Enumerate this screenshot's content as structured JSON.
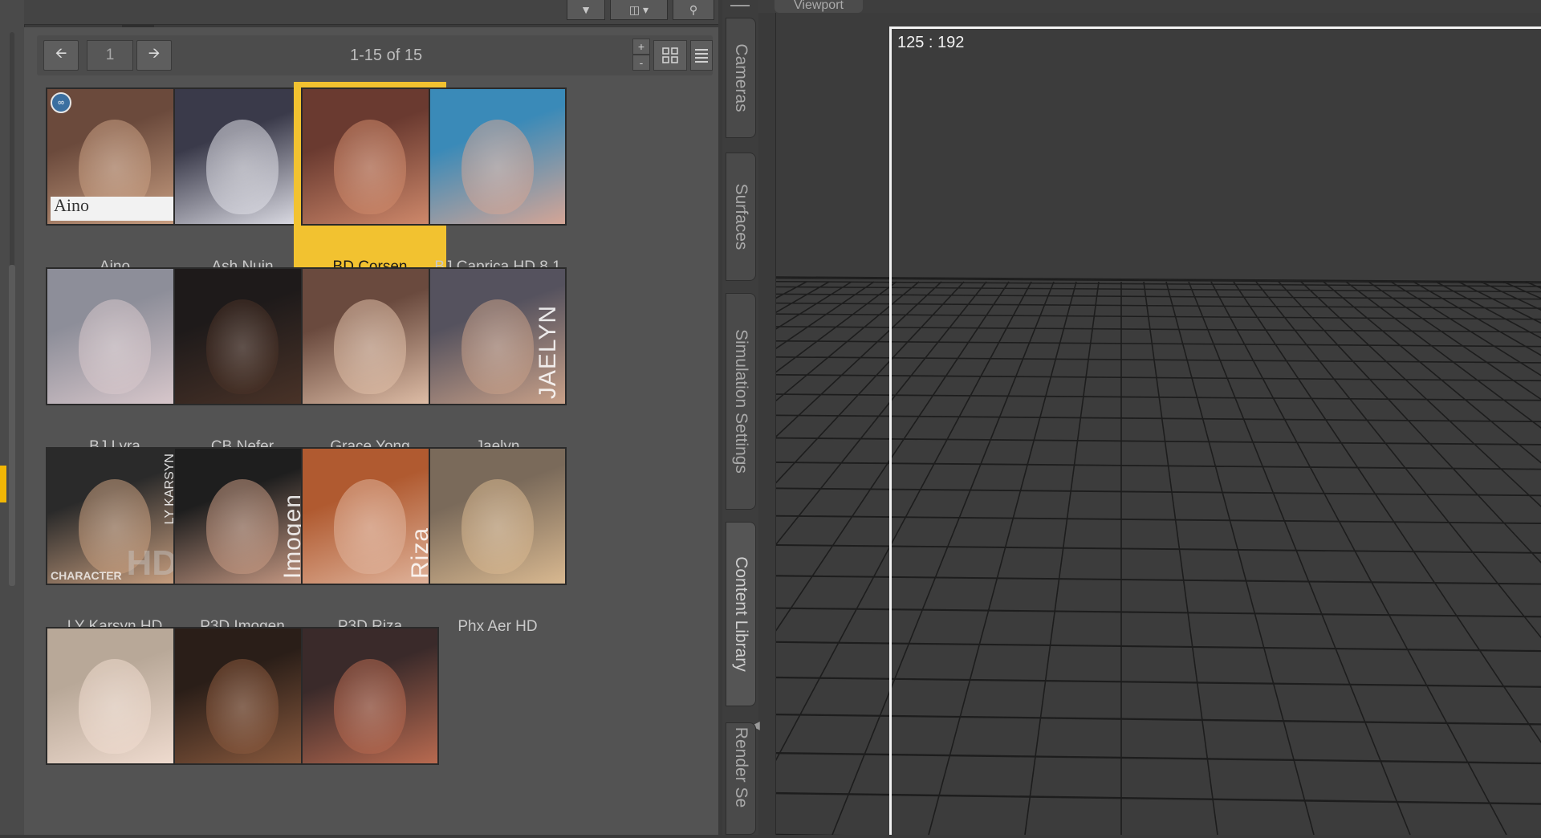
{
  "topbar": {
    "filter_icon": "funnel-icon",
    "db_icon": "database-icon",
    "search_icon": "search-icon"
  },
  "library": {
    "page_number": "1",
    "page_range": "1-15 of 15",
    "prev_icon": "arrow-left-icon",
    "next_icon": "arrow-right-icon",
    "zoom_in": "+",
    "zoom_out": "-",
    "selected_color": "#f2c230",
    "items": [
      {
        "label": "Aino",
        "colors": [
          "#6b4a3c",
          "#caa083"
        ],
        "card_text": "Aino"
      },
      {
        "label": "Ash Nuin",
        "colors": [
          "#3a3a4a",
          "#e0e0e8"
        ]
      },
      {
        "label": "BD Corsen",
        "colors": [
          "#6a3a30",
          "#d08a6c"
        ]
      },
      {
        "label": "BJ Caprica HD 8.1",
        "colors": [
          "#3a8ab8",
          "#d4a596"
        ]
      },
      {
        "label": "BJ Lyra",
        "colors": [
          "#8d8e99",
          "#d9c8cc"
        ]
      },
      {
        "label": "CB Nefer",
        "colors": [
          "#1e1a1a",
          "#4a3328"
        ]
      },
      {
        "label": "Grace Yong",
        "colors": [
          "#6a4a3e",
          "#e0bfa8"
        ]
      },
      {
        "label": "Jaelyn",
        "colors": [
          "#55525e",
          "#c8a088"
        ],
        "overlay": "JAELYN"
      },
      {
        "label": "LY Karsyn HD",
        "colors": [
          "#2a2a2a",
          "#caa080"
        ],
        "overlay_small": "LY KARSYN",
        "overlay_bottom": "CHARACTER",
        "overlay_hd": "HD"
      },
      {
        "label": "P3D Imogen",
        "colors": [
          "#1e1e1e",
          "#c89a84"
        ],
        "overlay": "Imogen"
      },
      {
        "label": "P3D Riza",
        "colors": [
          "#b05a30",
          "#e0b49c"
        ],
        "overlay": "Riza"
      },
      {
        "label": "Phx Aer HD",
        "colors": [
          "#7a6a5a",
          "#d8b890"
        ]
      },
      {
        "label": "",
        "colors": [
          "#b8a898",
          "#f0dcd0"
        ]
      },
      {
        "label": "",
        "colors": [
          "#2a1e18",
          "#8a5a3e"
        ]
      },
      {
        "label": "",
        "colors": [
          "#3a2a2a",
          "#b86a50"
        ]
      }
    ]
  },
  "tabs": [
    {
      "label": "Cameras"
    },
    {
      "label": "Surfaces"
    },
    {
      "label": "Simulation Settings"
    },
    {
      "label": "Content Library",
      "active": true
    },
    {
      "label": "Render Se"
    }
  ],
  "viewport": {
    "tab_label": "Viewport",
    "frame_label": "125 : 192"
  }
}
